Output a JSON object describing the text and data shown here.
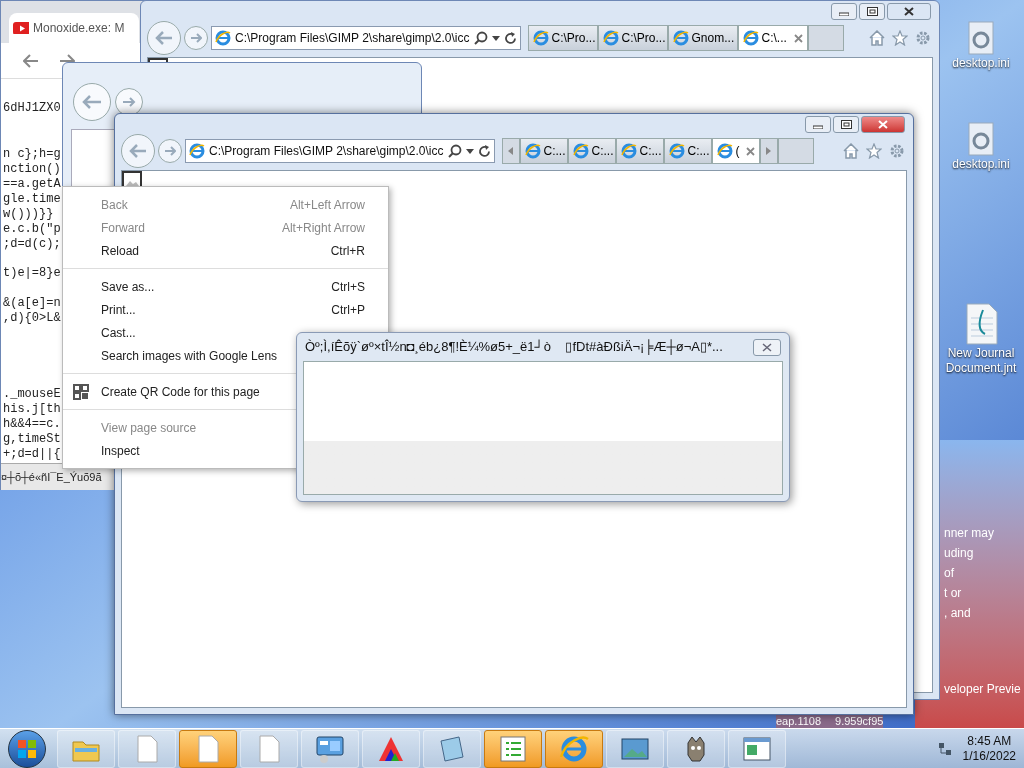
{
  "chrome_window": {
    "tab_title": "Monoxide.exe: M",
    "code_groups": [
      [
        "6dHJ1ZX0"
      ],
      [
        "n c};h=g",
        "nction()",
        "==a.getA",
        "gle.time",
        "w()))}}",
        "e.c.b(\"p",
        ";d=d(c);"
      ],
      [
        "t)e|=8}e"
      ],
      [
        "&(a[e]=n",
        ",d){0>L&"
      ],
      [
        "._mouseE",
        "his.j[th",
        "h&&4==c.",
        "g,timeSt",
        "+;d=d||{"
      ]
    ],
    "garbled_text": "¤┼õ┼é«ñI¯E_Ýuõ9ã"
  },
  "ie_window_back": {
    "address": "C:\\Program Files\\GIMP 2\\share\\gimp\\2.0\\icc",
    "tabs": [
      {
        "label": "C:\\Pro...",
        "selected": false
      },
      {
        "label": "C:\\Pro...",
        "selected": false
      },
      {
        "label": "Gnom...",
        "selected": false
      },
      {
        "label": "C:\\...",
        "selected": true
      }
    ]
  },
  "ie_window_front": {
    "address": "C:\\Program Files\\GIMP 2\\share\\gimp\\2.0\\icc",
    "tabs": [
      {
        "label": "C:...",
        "selected": false
      },
      {
        "label": "C:...",
        "selected": false
      },
      {
        "label": "C:...",
        "selected": false
      },
      {
        "label": "C:...",
        "selected": false
      },
      {
        "label": "(",
        "selected": true
      }
    ]
  },
  "context_menu": [
    {
      "kind": "item",
      "label": "Back",
      "shortcut": "Alt+Left Arrow",
      "disabled": true
    },
    {
      "kind": "item",
      "label": "Forward",
      "shortcut": "Alt+Right Arrow",
      "disabled": true
    },
    {
      "kind": "item",
      "label": "Reload",
      "shortcut": "Ctrl+R",
      "disabled": false
    },
    {
      "kind": "separator"
    },
    {
      "kind": "item",
      "label": "Save as...",
      "shortcut": "Ctrl+S",
      "disabled": false
    },
    {
      "kind": "item",
      "label": "Print...",
      "shortcut": "Ctrl+P",
      "disabled": false
    },
    {
      "kind": "item",
      "label": "Cast...",
      "disabled": false
    },
    {
      "kind": "item",
      "label": "Search images with Google Lens",
      "disabled": false
    },
    {
      "kind": "separator"
    },
    {
      "kind": "qr",
      "label": "Create QR Code for this page",
      "disabled": false
    },
    {
      "kind": "separator"
    },
    {
      "kind": "item",
      "label": "View page source",
      "disabled": true
    },
    {
      "kind": "item",
      "label": "Inspect",
      "disabled": false
    }
  ],
  "dialog": {
    "title": "Òº;Ì,íÊõÿ`øº×tÎ½n◘¸éb¿8¶!È¼%ø5+_ë1┘ò    ▯fDt#àÐßiÄ¬¡╞Æ┼ø¬A▯*..."
  },
  "desktop": {
    "icons": [
      {
        "kind": "settings-file",
        "label": "desktop.ini"
      },
      {
        "kind": "settings-file",
        "label": "desktop.ini"
      },
      {
        "kind": "journal",
        "label": "New Journal Document.jnt"
      }
    ],
    "text_fragments": [
      "nner may",
      "uding",
      "of",
      "t or",
      ", and",
      "veloper Previe"
    ],
    "bottom_fragments": [
      "eap.1108",
      "9.959cf95"
    ]
  },
  "taskbar": {
    "items": [
      {
        "kind": "folder",
        "active": false
      },
      {
        "kind": "document",
        "active": false
      },
      {
        "kind": "document",
        "active": true
      },
      {
        "kind": "document",
        "active": false
      },
      {
        "kind": "control-panel",
        "active": false
      },
      {
        "kind": "paint",
        "active": false
      },
      {
        "kind": "notepad",
        "active": false
      },
      {
        "kind": "list",
        "active": true
      },
      {
        "kind": "browser",
        "active": true
      },
      {
        "kind": "photo",
        "active": false
      },
      {
        "kind": "gimp",
        "active": false
      },
      {
        "kind": "window",
        "active": false
      }
    ],
    "time": "8:45 AM",
    "date": "1/16/2022"
  }
}
